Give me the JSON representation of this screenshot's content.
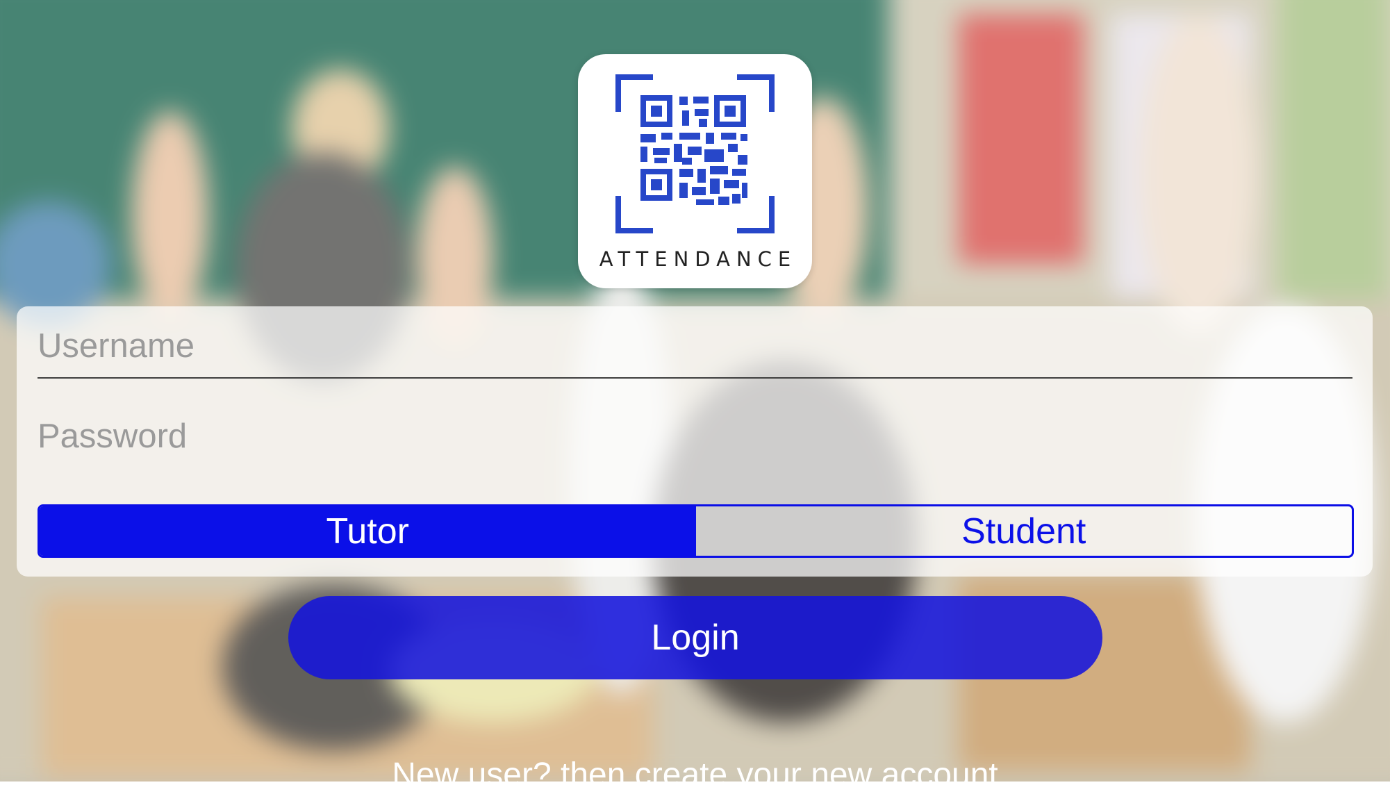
{
  "logo": {
    "caption": "ATTENDANCE",
    "icon": "qr-code-icon",
    "accent": "#2747c9"
  },
  "form": {
    "username_placeholder": "Username",
    "password_placeholder": "Password",
    "role_options": [
      "Tutor",
      "Student"
    ],
    "selected_role": "Tutor"
  },
  "login_label": "Login",
  "signup_text": "New user? then create your new account",
  "colors": {
    "primary": "#0b10e8",
    "login_button": "#1414dc"
  }
}
